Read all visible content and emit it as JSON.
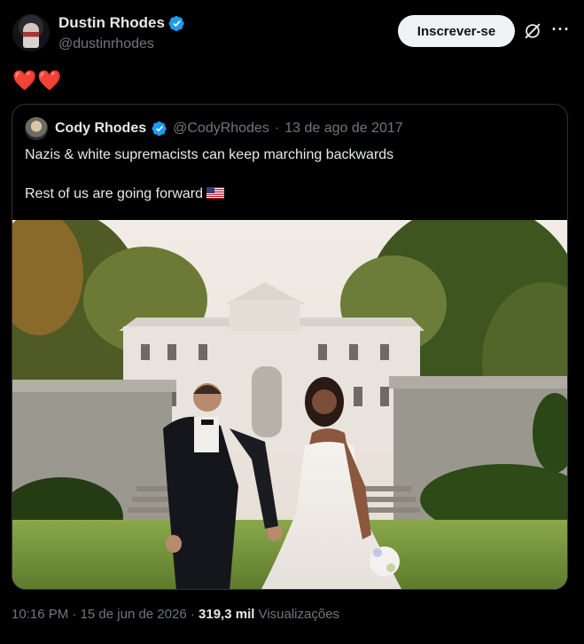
{
  "author": {
    "display_name": "Dustin Rhodes",
    "handle": "@dustinrhodes",
    "verified_icon": "verified-badge-icon"
  },
  "actions": {
    "subscribe_label": "Inscrever-se",
    "grok_icon": "grok-icon",
    "more_icon": "more-options-icon"
  },
  "tweet": {
    "text": "❤️❤️"
  },
  "quoted": {
    "display_name": "Cody Rhodes",
    "handle": "@CodyRhodes",
    "separator": "·",
    "date": "13 de ago de 2017",
    "line1": "Nazis & white supremacists can keep marching backwards",
    "line2": "Rest of us are going forward",
    "photo_alt": "Couple in wedding attire standing on lawn in front of white mansion"
  },
  "meta": {
    "time": "10:16 PM",
    "separator": "·",
    "date": "15 de jun de 2026",
    "views_count": "319,3 mil",
    "views_label": "Visualizações"
  },
  "colors": {
    "background": "#000000",
    "text": "#e7e9ea",
    "muted": "#71767b",
    "verified": "#1d9bf0",
    "heart": "#f4212e",
    "border": "#2f3336"
  }
}
